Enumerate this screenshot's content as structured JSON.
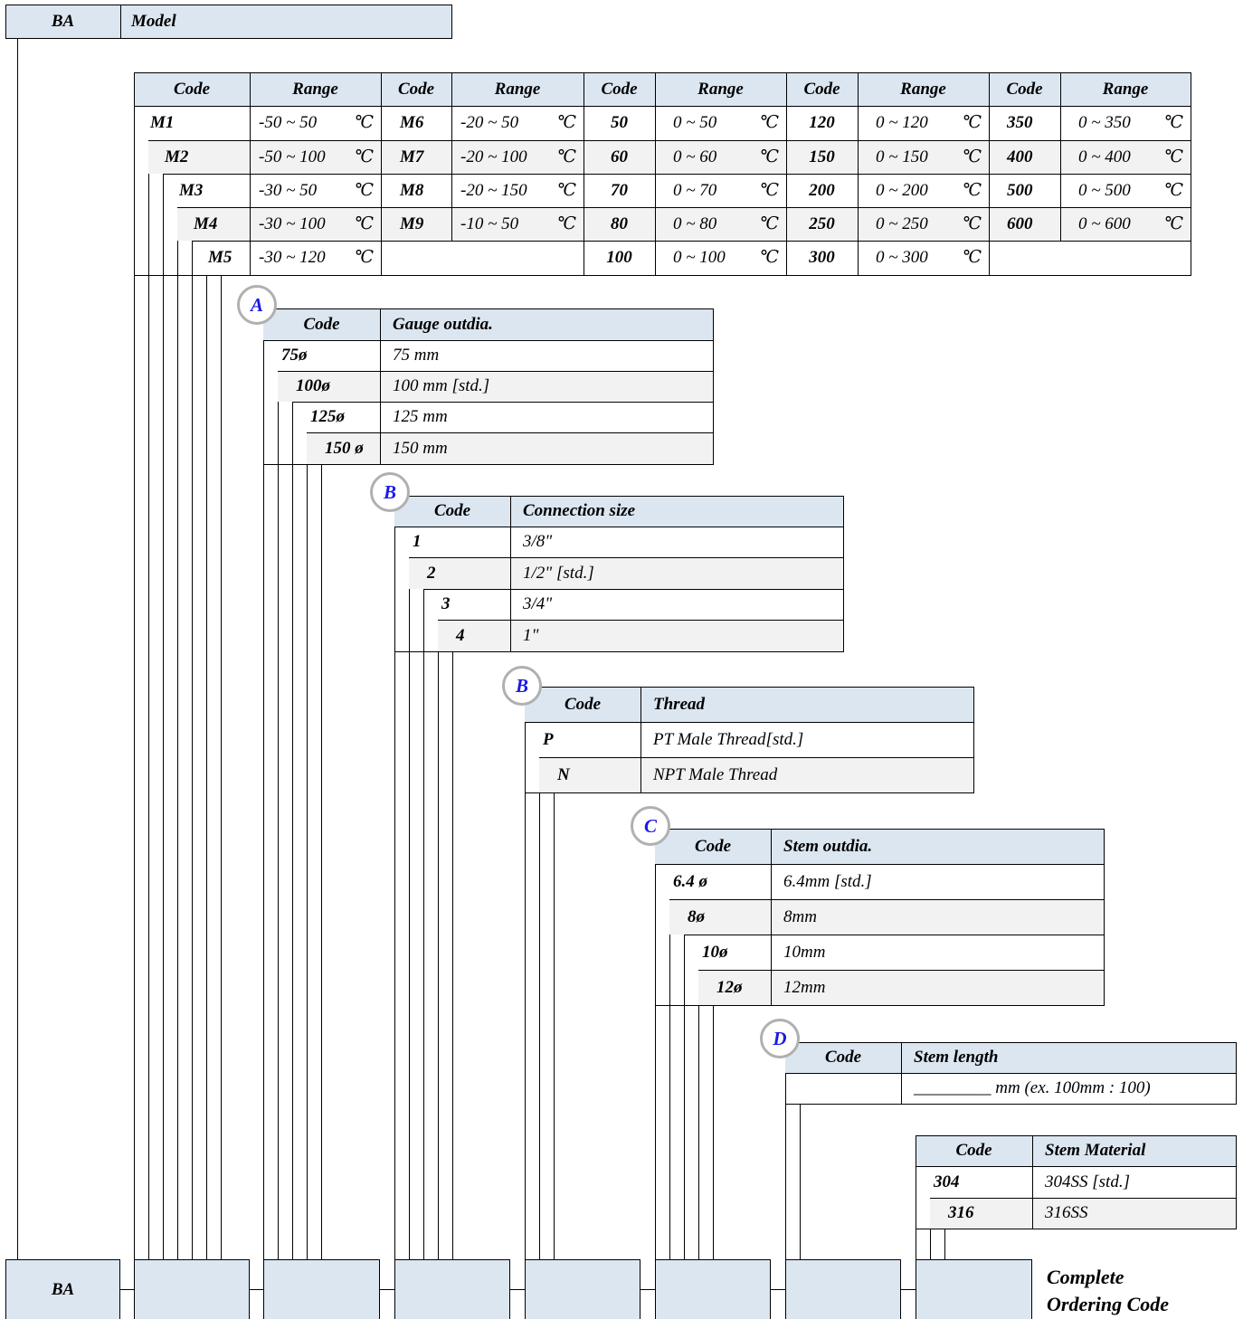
{
  "model": {
    "code": "BA",
    "label": "Model"
  },
  "range_table": {
    "headers": [
      "Code",
      "Range",
      "Code",
      "Range",
      "Code",
      "Range",
      "Code",
      "Range",
      "Code",
      "Range"
    ],
    "unit": "℃",
    "col1": [
      {
        "code": "M1",
        "range": "-50 ~  50"
      },
      {
        "code": "M2",
        "range": "-50 ~ 100"
      },
      {
        "code": "M3",
        "range": "-30 ~  50"
      },
      {
        "code": "M4",
        "range": "-30 ~ 100"
      },
      {
        "code": "M5",
        "range": "-30 ~ 120"
      }
    ],
    "col2": [
      {
        "code": "M6",
        "range": "-20 ~   50"
      },
      {
        "code": "M7",
        "range": "-20 ~ 100"
      },
      {
        "code": "M8",
        "range": "-20 ~ 150"
      },
      {
        "code": "M9",
        "range": "-10 ~   50"
      }
    ],
    "col3": [
      {
        "code": "50",
        "range": "0 ~  50"
      },
      {
        "code": "60",
        "range": "0 ~  60"
      },
      {
        "code": "70",
        "range": "0 ~  70"
      },
      {
        "code": "80",
        "range": "0 ~  80"
      },
      {
        "code": "100",
        "range": "0 ~ 100"
      }
    ],
    "col4": [
      {
        "code": "120",
        "range": "0 ~ 120"
      },
      {
        "code": "150",
        "range": "0 ~ 150"
      },
      {
        "code": "200",
        "range": "0 ~ 200"
      },
      {
        "code": "250",
        "range": "0 ~ 250"
      },
      {
        "code": "300",
        "range": "0 ~ 300"
      }
    ],
    "col5": [
      {
        "code": "350",
        "range": "0 ~ 350"
      },
      {
        "code": "400",
        "range": "0 ~ 400"
      },
      {
        "code": "500",
        "range": "0 ~ 500"
      },
      {
        "code": "600",
        "range": "0 ~ 600"
      }
    ]
  },
  "gauge": {
    "marker": "A",
    "headers": [
      "Code",
      "Gauge outdia."
    ],
    "rows": [
      {
        "code": "75ø",
        "desc": "75 mm"
      },
      {
        "code": "100ø",
        "desc": "100 mm [std.]"
      },
      {
        "code": "125ø",
        "desc": "125 mm"
      },
      {
        "code": "150 ø",
        "desc": "150 mm"
      }
    ]
  },
  "connection": {
    "marker": "B",
    "headers": [
      "Code",
      "Connection size"
    ],
    "rows": [
      {
        "code": "1",
        "desc": "3/8\""
      },
      {
        "code": "2",
        "desc": "1/2\" [std.]"
      },
      {
        "code": "3",
        "desc": "3/4\""
      },
      {
        "code": "4",
        "desc": "1\""
      }
    ]
  },
  "thread": {
    "marker": "B",
    "headers": [
      "Code",
      "Thread"
    ],
    "rows": [
      {
        "code": "P",
        "desc": "PT Male Thread[std.]"
      },
      {
        "code": "N",
        "desc": "NPT Male Thread"
      }
    ]
  },
  "stem_outdia": {
    "marker": "C",
    "headers": [
      "Code",
      "Stem outdia."
    ],
    "rows": [
      {
        "code": "6.4 ø",
        "desc": "6.4mm [std.]"
      },
      {
        "code": "8ø",
        "desc": "8mm"
      },
      {
        "code": "10ø",
        "desc": "10mm"
      },
      {
        "code": "12ø",
        "desc": "12mm"
      }
    ]
  },
  "stem_length": {
    "marker": "D",
    "headers": [
      "Code",
      "Stem length"
    ],
    "rows": [
      {
        "code": "",
        "desc": "_________ mm (ex. 100mm : 100)"
      }
    ]
  },
  "stem_material": {
    "headers": [
      "Code",
      "Stem Material"
    ],
    "rows": [
      {
        "code": "304",
        "desc": "304SS [std.]"
      },
      {
        "code": "316",
        "desc": "316SS"
      }
    ]
  },
  "ordering": {
    "model_code": "BA",
    "label_line1": "Complete",
    "label_line2": "Ordering Code"
  }
}
